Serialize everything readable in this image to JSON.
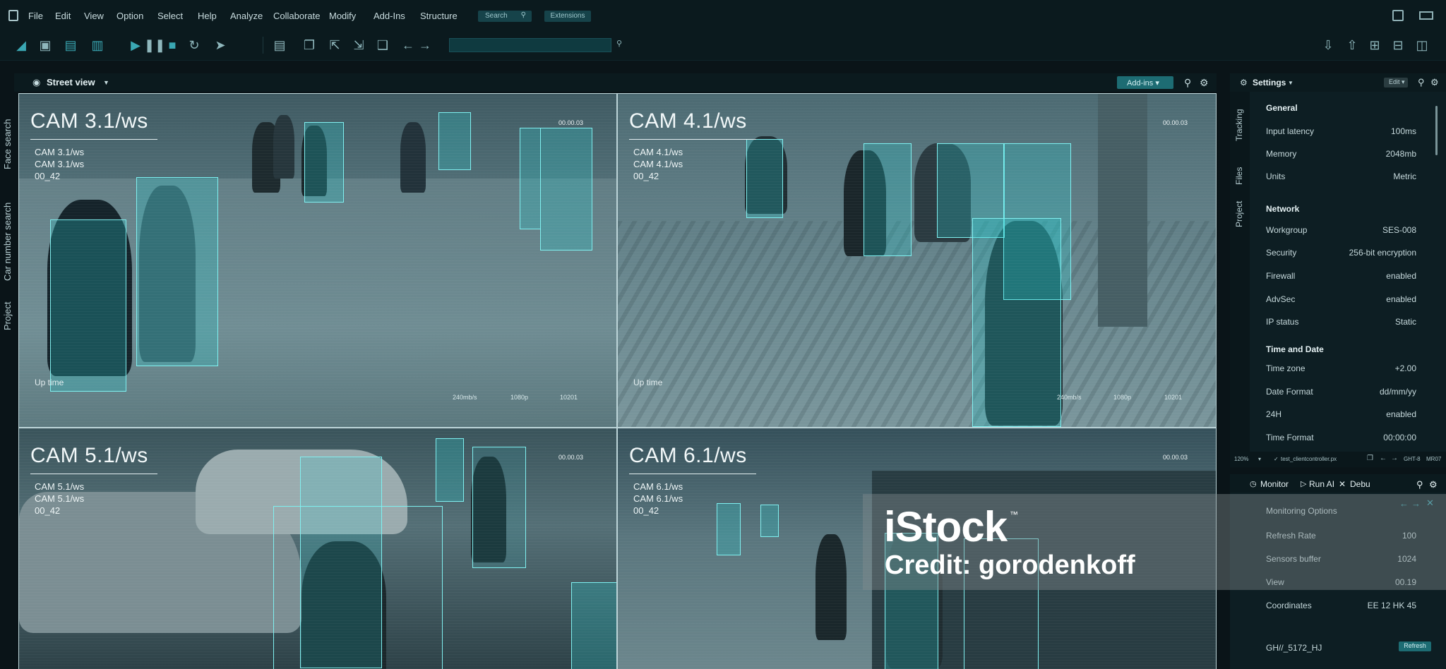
{
  "menu": {
    "items": [
      "File",
      "Edit",
      "View",
      "Option",
      "Select",
      "Help",
      "Analyze",
      "Collaborate",
      "Modify",
      "Add-Ins",
      "Structure"
    ],
    "search_label": "Search",
    "extensions_label": "Extensions"
  },
  "left_tabs": [
    "Face search",
    "Car number search",
    "Project"
  ],
  "street_view": {
    "title": "Street view",
    "addins_label": "Add-ins"
  },
  "cameras": [
    {
      "title": "CAM 3.1/ws",
      "meta": [
        "CAM 3.1/ws",
        "CAM 3.1/ws",
        "00_42"
      ],
      "uptime": "Up time",
      "timecode": "00.00.03",
      "stats": [
        "240mb/s",
        "1080p",
        "10201"
      ]
    },
    {
      "title": "CAM 4.1/ws",
      "meta": [
        "CAM 4.1/ws",
        "CAM 4.1/ws",
        "00_42"
      ],
      "uptime": "Up time",
      "timecode": "00.00.03",
      "stats": [
        "240mb/s",
        "1080p",
        "10201"
      ]
    },
    {
      "title": "CAM 5.1/ws",
      "meta": [
        "CAM 5.1/ws",
        "CAM 5.1/ws",
        "00_42"
      ],
      "timecode": "00.00.03"
    },
    {
      "title": "CAM 6.1/ws",
      "meta": [
        "CAM 6.1/ws",
        "CAM 6.1/ws",
        "00_42"
      ],
      "timecode": "00.00.03"
    }
  ],
  "settings": {
    "title": "Settings",
    "edit_label": "Edit",
    "tabs": [
      "Tracking",
      "Files",
      "Project"
    ],
    "sections": [
      {
        "title": "General",
        "rows": [
          {
            "label": "Input latency",
            "value": "100ms"
          },
          {
            "label": "Memory",
            "value": "2048mb"
          },
          {
            "label": "Units",
            "value": "Metric"
          }
        ]
      },
      {
        "title": "Network",
        "rows": [
          {
            "label": "Workgroup",
            "value": "SES-008"
          },
          {
            "label": "Security",
            "value": "256-bit encryption"
          },
          {
            "label": "Firewall",
            "value": "enabled"
          },
          {
            "label": "AdvSec",
            "value": "enabled"
          },
          {
            "label": "IP status",
            "value": "Static"
          }
        ]
      },
      {
        "title": "Time and Date",
        "rows": [
          {
            "label": "Time zone",
            "value": "+2.00"
          },
          {
            "label": "Date Format",
            "value": "dd/mm/yy"
          },
          {
            "label": "24H",
            "value": "enabled"
          },
          {
            "label": "Time Format",
            "value": "00:00:00"
          }
        ]
      }
    ],
    "status": {
      "zoom": "120%",
      "file": "test_clientcontroller.px",
      "code1": "GHT-8",
      "code2": "MR07"
    }
  },
  "monitor": {
    "tabs": [
      "Monitor",
      "Run AI",
      "Debu"
    ],
    "options_title": "Monitoring Options",
    "rows": [
      {
        "label": "Refresh Rate",
        "value": "100"
      },
      {
        "label": "Sensors buffer",
        "value": "1024"
      },
      {
        "label": "View",
        "value": "00.19"
      },
      {
        "label": "Coordinates",
        "value": "EE 12 HK 45"
      }
    ],
    "id": "GH//_5172_HJ",
    "refresh_label": "Refresh"
  },
  "watermark": {
    "logo": "iStock",
    "tm": "™",
    "credit": "Credit: gorodenkoff"
  },
  "icons": [
    "app-icon",
    "search-icon",
    "gear-icon",
    "eye-icon",
    "play-icon",
    "pause-icon",
    "stop-icon",
    "cursor-icon",
    "arrow-left-icon",
    "arrow-right-icon",
    "trash-icon",
    "close-icon"
  ]
}
